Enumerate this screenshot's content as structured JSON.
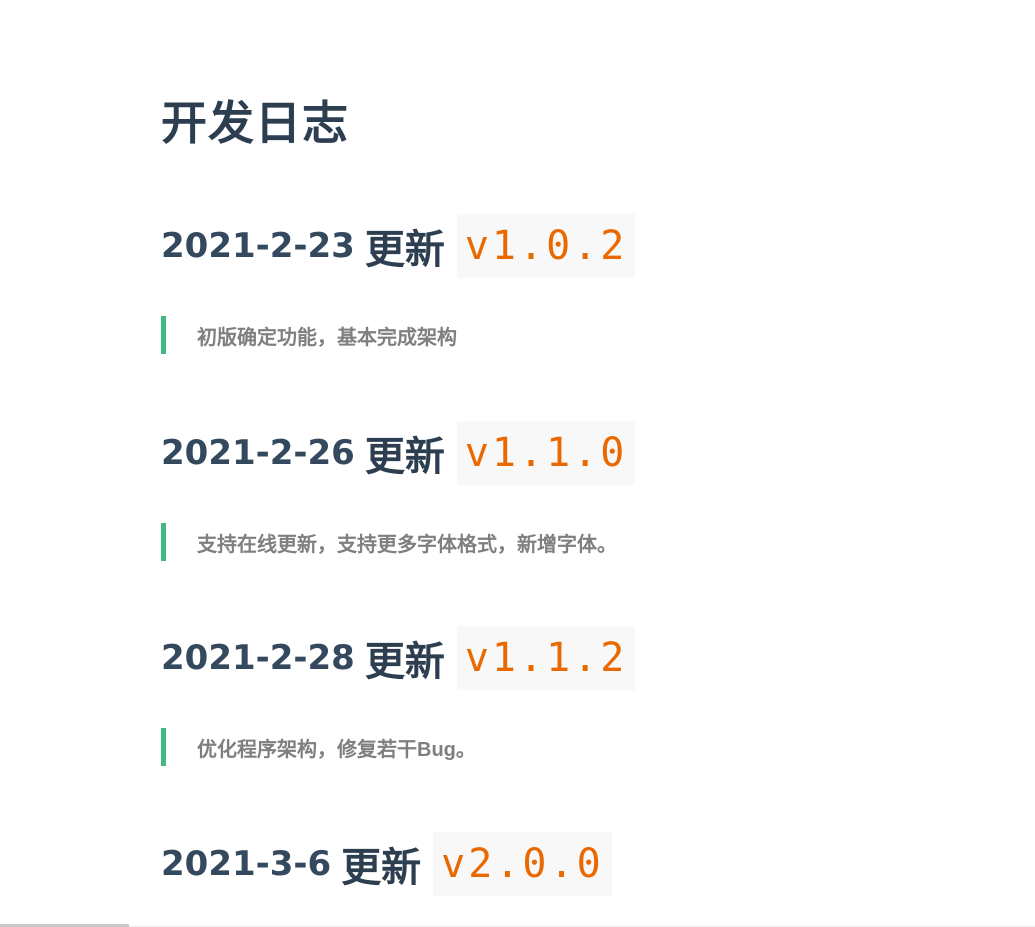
{
  "page": {
    "title": "开发日志"
  },
  "entries": [
    {
      "date": "2021-2-23",
      "word": "更新",
      "version": "v1.0.2",
      "note": "初版确定功能，基本完成架构"
    },
    {
      "date": "2021-2-26",
      "word": "更新",
      "version": "v1.1.0",
      "note": "支持在线更新，支持更多字体格式，新增字体。"
    },
    {
      "date": "2021-2-28",
      "word": "更新",
      "version": "v1.1.2",
      "note": "优化程序架构，修复若干Bug。"
    },
    {
      "date": "2021-3-6",
      "word": "更新",
      "version": "v2.0.0",
      "note": ""
    }
  ],
  "colors": {
    "heading": "#34495e",
    "version_text": "#e96900",
    "version_bg": "#f8f8f8",
    "quote_border": "#42b983",
    "quote_text": "#7f7f7f"
  }
}
